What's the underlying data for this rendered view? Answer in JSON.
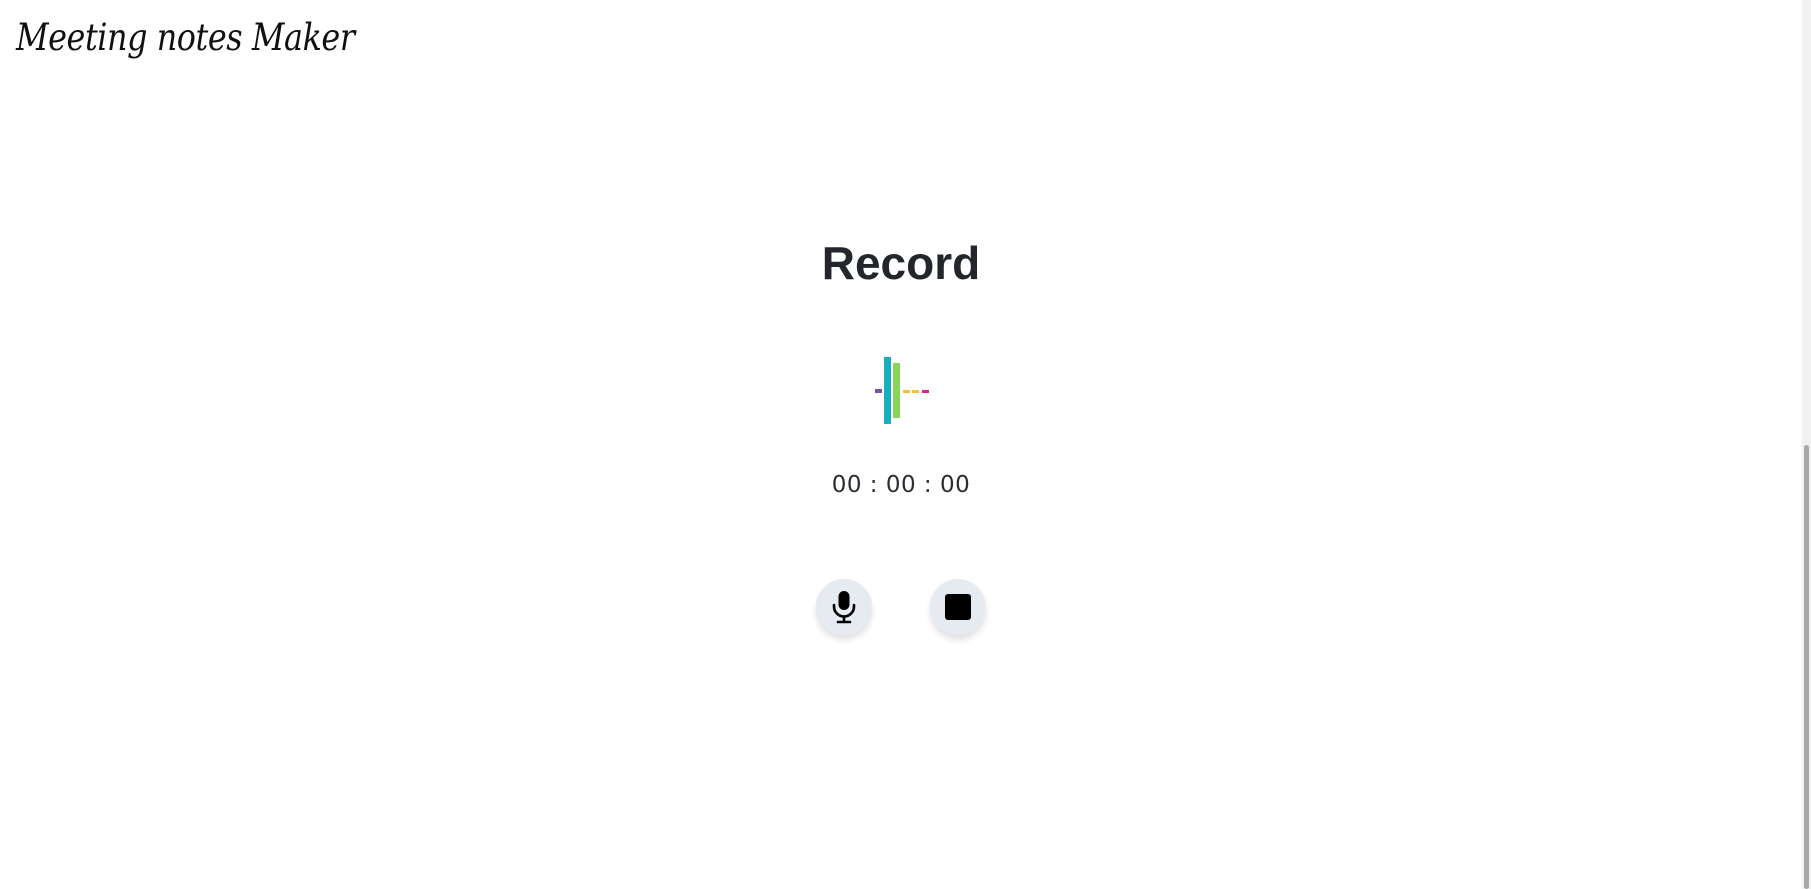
{
  "app": {
    "brand_title": "Meeting notes Maker"
  },
  "recorder": {
    "title": "Record",
    "timer": "00 : 00 : 00",
    "visualizer_colors": [
      "#7b4fa6",
      "#17aebf",
      "#8ad45c",
      "#f2c12e",
      "#f2c12e",
      "#e0247a"
    ]
  },
  "controls": {
    "mic_icon": "microphone-icon",
    "stop_icon": "stop-icon"
  },
  "colors": {
    "button_bg": "#e6ebf2",
    "title_text": "#23272b"
  }
}
